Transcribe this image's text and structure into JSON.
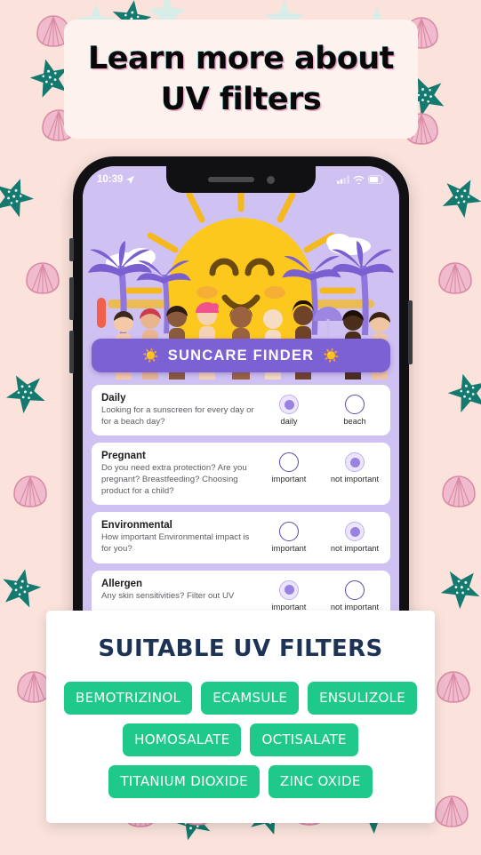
{
  "promo": {
    "line1": "Learn more about",
    "line2": "UV filters"
  },
  "phone": {
    "status_bar": {
      "time": "10:39",
      "location_icon": "location-arrow-icon",
      "cellular_icon": "cellular-bars-icon",
      "wifi_icon": "wifi-icon",
      "battery_icon": "battery-icon"
    },
    "app": {
      "banner_title": "SUNCARE FINDER",
      "banner_icon_left": "sun-icon",
      "banner_icon_right": "sun-icon",
      "questions": [
        {
          "title": "Daily",
          "desc": "Looking for a sunscreen for every day or for a beach day?",
          "options": [
            {
              "label": "daily",
              "selected": true
            },
            {
              "label": "beach",
              "selected": false
            }
          ]
        },
        {
          "title": "Pregnant",
          "desc": "Do you need extra protection? Are you pregnant? Breastfeeding? Choosing product for a child?",
          "options": [
            {
              "label": "important",
              "selected": false
            },
            {
              "label": "not important",
              "selected": true
            }
          ]
        },
        {
          "title": "Environmental",
          "desc": "How important Environmental impact is for you?",
          "options": [
            {
              "label": "important",
              "selected": false
            },
            {
              "label": "not important",
              "selected": true
            }
          ]
        },
        {
          "title": "Allergen",
          "desc": "Any skin sensitivities? Filter out UV",
          "options": [
            {
              "label": "important",
              "selected": true
            },
            {
              "label": "not important",
              "selected": false
            }
          ]
        }
      ]
    }
  },
  "results": {
    "title": "SUITABLE UV FILTERS",
    "rows": [
      [
        "BEMOTRIZINOL",
        "ECAMSULE",
        "ENSULIZOLE"
      ],
      [
        "HOMOSALATE",
        "OCTISALATE"
      ],
      [
        "TITANIUM DIOXIDE",
        "ZINC OXIDE"
      ]
    ]
  },
  "colors": {
    "page_background": "#fbe3dc",
    "promo_background": "#fdf2ee",
    "screen_background": "#cfc2f2",
    "banner_purple": "#7b61d4",
    "pill_green": "#1fc98a",
    "results_title_navy": "#1c3355",
    "shell_pink": "#e7a8bc",
    "starfish_teal": "#1b8276"
  }
}
